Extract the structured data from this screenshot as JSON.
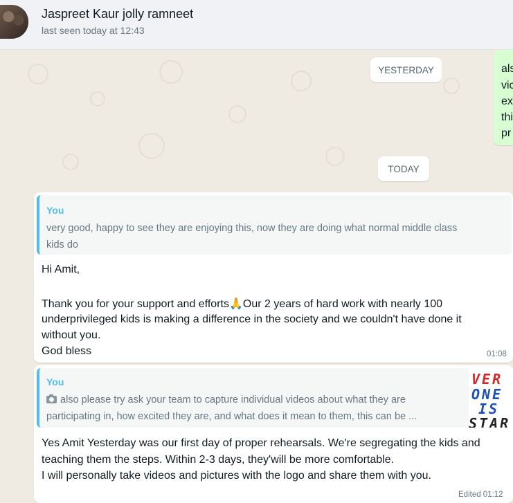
{
  "header": {
    "contact_name": "Jaspreet Kaur jolly ramneet",
    "last_seen": "last seen today at 12:43"
  },
  "dates": {
    "yesterday": "YESTERDAY",
    "today": "TODAY"
  },
  "outgoing_partial": {
    "lines": [
      "als",
      "vic",
      "ex",
      "thi",
      "pr"
    ]
  },
  "message1": {
    "quote_author": "You",
    "quote_lines": [
      "very good, happy to see they are enjoying this, now they are doing what normal middle class",
      "kids do"
    ],
    "lines": [
      "Hi Amit,",
      "",
      "Thank you for your support and efforts",
      "underprivileged kids is making a difference in the  society and we couldn't have done it",
      "without you.",
      "God bless"
    ],
    "line3_suffix": "Our 2 years of hard work with nearly 100",
    "emoji": "🙏",
    "time": "01:08"
  },
  "message2": {
    "quote_author": "You",
    "quote_lines": [
      "also please try ask your team to capture individual videos about what they are",
      "participating in, how excited they are, and what does it mean to them, this can be ..."
    ],
    "thumbnail_lines": [
      "VER",
      "ONE",
      "IS",
      "STAR"
    ],
    "lines": [
      "Yes Amit Yesterday was our first day of proper rehearsals. We're segregating the kids and",
      "teaching them the steps. Within 2-3 days, they'will be more comfortable.",
      "I will personally take videos and pictures with the logo and share them with you."
    ],
    "time": "Edited 01:12"
  },
  "icons": {
    "quote_media": "camera-icon"
  },
  "colors": {
    "chat_background": "#efeae2",
    "outgoing_bubble": "#d9fdd3",
    "quote_accent": "#53bdeb"
  }
}
